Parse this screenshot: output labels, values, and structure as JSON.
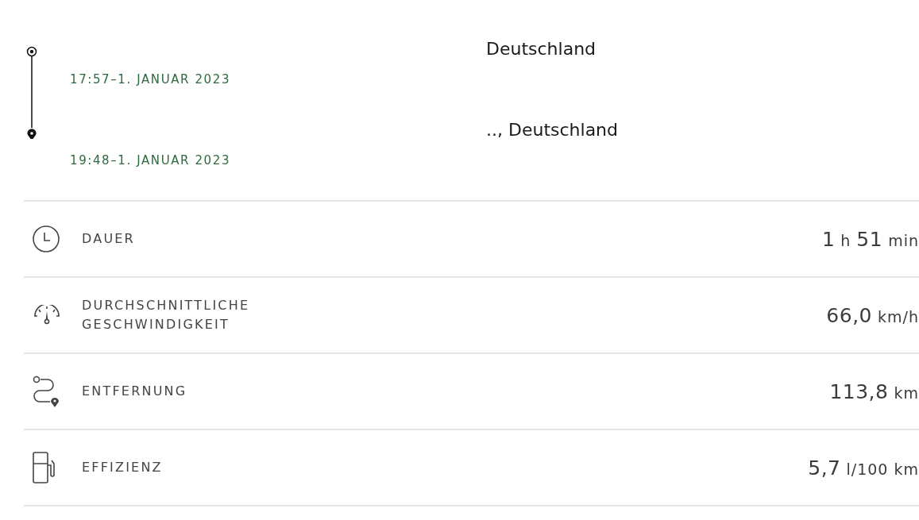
{
  "stops": [
    {
      "kind": "start",
      "address": "Deutschland",
      "time": "17:57–1. JANUAR 2023"
    },
    {
      "kind": "end",
      "address": ".., Deutschland",
      "time": "19:48–1. JANUAR 2023"
    }
  ],
  "stats": [
    {
      "kind": "clock",
      "label": "DAUER",
      "value": [
        {
          "kind": "number",
          "text": "1"
        },
        {
          "kind": "unit",
          "text": "h"
        },
        {
          "kind": "number",
          "text": "51"
        },
        {
          "kind": "unit",
          "text": "min"
        }
      ]
    },
    {
      "kind": "gauge",
      "label": "DURCHSCHNITTLICHE GESCHWINDIGKEIT",
      "value": [
        {
          "kind": "number",
          "text": "66,0"
        },
        {
          "kind": "unit",
          "text": "km/h"
        }
      ]
    },
    {
      "kind": "route",
      "label": "ENTFERNUNG",
      "value": [
        {
          "kind": "number",
          "text": "113,8"
        },
        {
          "kind": "unit",
          "text": "km"
        }
      ]
    },
    {
      "kind": "fuel",
      "label": "EFFIZIENZ",
      "value": [
        {
          "kind": "number",
          "text": "5,7"
        },
        {
          "kind": "unit",
          "text": "l/100 km"
        }
      ]
    }
  ]
}
